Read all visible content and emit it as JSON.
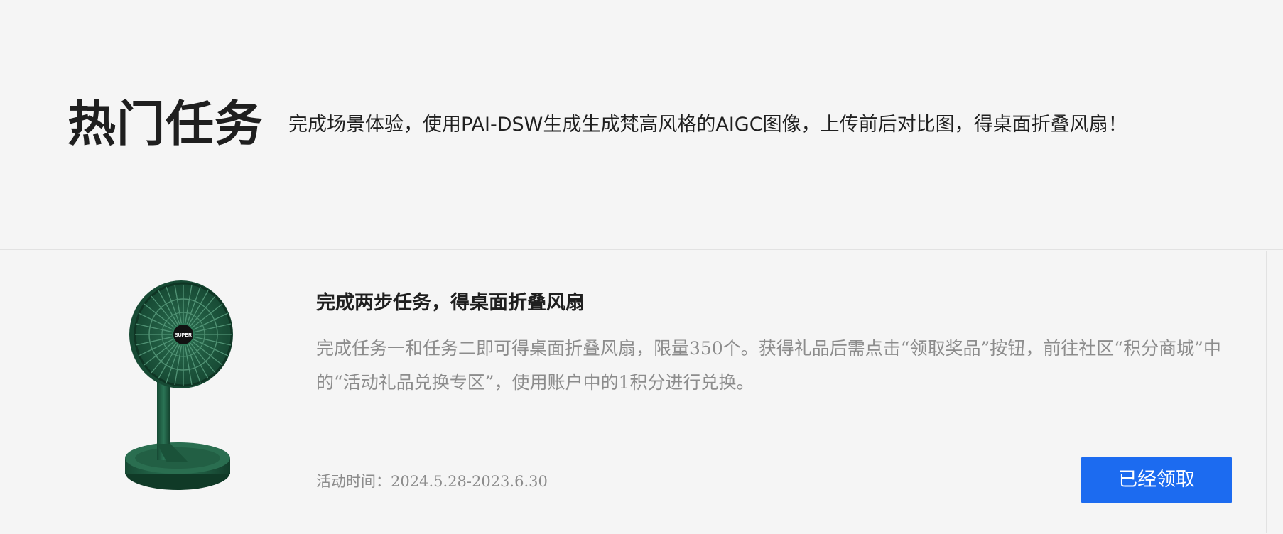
{
  "header": {
    "title": "热门任务",
    "subtitle": "完成场景体验，使用PAI-DSW生成生成梵高风格的AIGC图像，上传前后对比图，得桌面折叠风扇！"
  },
  "task_card": {
    "title": "完成两步任务，得桌面折叠风扇",
    "description": "完成任务一和任务二即可得桌面折叠风扇，限量350个。获得礼品后需点击“领取奖品”按钮，前往社区“积分商城”中的“活动礼品兑换专区”，使用账户中的1积分进行兑换。",
    "time_label": "活动时间：",
    "time_value": "2024.5.28-2023.6.30",
    "button_label": "已经领取",
    "product_logo": "SUPER",
    "colors": {
      "fan_green": "#1d5a40",
      "button_blue": "#1c6bf0"
    }
  }
}
